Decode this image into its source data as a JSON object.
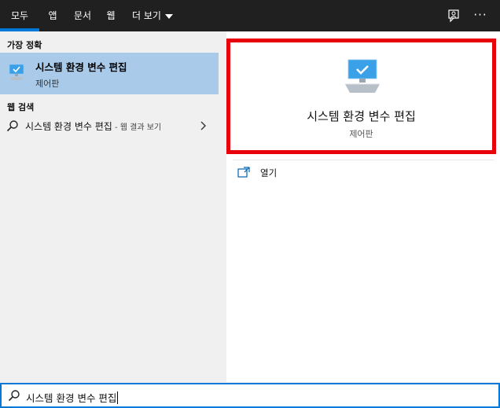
{
  "tabs": [
    {
      "label": "모두",
      "active": true
    },
    {
      "label": "앱"
    },
    {
      "label": "문서"
    },
    {
      "label": "웹"
    },
    {
      "label": "더 보기"
    }
  ],
  "top_icons": [
    "feedback-icon",
    "more-options-icon"
  ],
  "more_options_glyph": "···",
  "colors": {
    "topbar": "#202020",
    "accent": "#0078d7",
    "selected_item": "#a9cbe9",
    "highlight_border": "#e8000b"
  },
  "left": {
    "best_match_heading": "가장 정확",
    "best_match": {
      "title": "시스템 환경 변수 편집",
      "subtitle": "제어판",
      "icon": "monitor-check-icon"
    },
    "web_heading": "웹 검색",
    "web_result": {
      "query": "시스템 환경 변수 편집",
      "suffix": " - 웹 결과 보기",
      "icon": "search-icon"
    }
  },
  "right": {
    "title": "시스템 환경 변수 편집",
    "subtitle": "제어판",
    "icon": "monitor-check-icon",
    "actions": [
      {
        "label": "열기",
        "icon": "open-icon"
      }
    ]
  },
  "search": {
    "value": "시스템 환경 변수 편집",
    "icon": "search-icon"
  }
}
